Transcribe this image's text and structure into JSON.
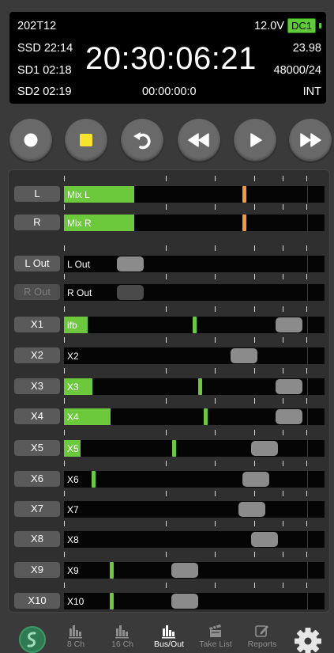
{
  "display": {
    "project": "202T12",
    "voltage": "12.0V",
    "power_source": "DC1",
    "ssd_time": "SSD 22:14",
    "sd1_time": "SD1 02:18",
    "sd2_time": "SD2 02:19",
    "timecode": "20:30:06:21",
    "frame_rate": "23.98",
    "sample_format": "48000/24",
    "take_duration": "00:00:00:0",
    "tc_source": "INT"
  },
  "transport": {
    "record_icon": "record-icon",
    "stop_icon": "stop-icon",
    "undo_icon": "undo-icon",
    "rewind_icon": "rewind-icon",
    "play_icon": "play-icon",
    "fast_forward_icon": "fast-forward-icon",
    "stop_color": "#f7e32c"
  },
  "mixer": {
    "rows": [
      {
        "button": "L",
        "label": "Mix L",
        "level": 0.27,
        "peak": 0.685,
        "peak_color": "#f29a3a",
        "fader": null,
        "dim": false
      },
      {
        "button": "R",
        "label": "Mix R",
        "level": 0.27,
        "peak": 0.685,
        "peak_color": "#f29a3a",
        "fader": null,
        "dim": false
      },
      {
        "button": "L Out",
        "label": "L Out",
        "level": 0,
        "peak": null,
        "fader": 0.255,
        "dim": false
      },
      {
        "button": "R Out",
        "label": "R Out",
        "level": 0,
        "peak": null,
        "fader": 0.255,
        "dim": true
      },
      {
        "button": "X1",
        "label": "ifb",
        "level": 0.09,
        "peak": 0.495,
        "peak_color": "#6cc93c",
        "fader": 0.865,
        "dim": false
      },
      {
        "button": "X2",
        "label": "X2",
        "level": 0,
        "peak": null,
        "fader": 0.69,
        "dim": false
      },
      {
        "button": "X3",
        "label": "X3",
        "level": 0.11,
        "peak": 0.515,
        "peak_color": "#6cc93c",
        "fader": 0.865,
        "dim": false
      },
      {
        "button": "X4",
        "label": "X4",
        "level": 0.18,
        "peak": 0.535,
        "peak_color": "#6cc93c",
        "fader": 0.865,
        "dim": false
      },
      {
        "button": "X5",
        "label": "X5",
        "level": 0.065,
        "peak": 0.415,
        "peak_color": "#6cc93c",
        "fader": 0.77,
        "dim": false
      },
      {
        "button": "X6",
        "label": "X6",
        "level": 0,
        "peak": 0.105,
        "peak_color": "#6cc93c",
        "fader": 0.735,
        "dim": false
      },
      {
        "button": "X7",
        "label": "X7",
        "level": 0,
        "peak": null,
        "fader": 0.72,
        "dim": false
      },
      {
        "button": "X8",
        "label": "X8",
        "level": 0,
        "peak": null,
        "fader": 0.77,
        "dim": false
      },
      {
        "button": "X9",
        "label": "X9",
        "level": 0,
        "peak": 0.175,
        "peak_color": "#6cc93c",
        "fader": 0.465,
        "dim": false
      },
      {
        "button": "X10",
        "label": "X10",
        "level": 0,
        "peak": 0.175,
        "peak_color": "#6cc93c",
        "fader": 0.465,
        "dim": false
      }
    ]
  },
  "tabbar": {
    "logo_icon": "app-logo-icon",
    "tabs": [
      {
        "label": "8 Ch",
        "icon": "meter-bars-icon",
        "active": false
      },
      {
        "label": "16 Ch",
        "icon": "meter-bars-icon",
        "active": false
      },
      {
        "label": "Bus/Out",
        "icon": "meter-bars-icon",
        "active": true
      },
      {
        "label": "Take List",
        "icon": "clapperboard-icon",
        "active": false
      },
      {
        "label": "Reports",
        "icon": "edit-icon",
        "active": false
      }
    ],
    "settings_icon": "gear-icon"
  },
  "colors": {
    "meter_green": "#6cc93c",
    "peak_orange": "#f29a3a",
    "power_badge": "#5fcb3a"
  }
}
